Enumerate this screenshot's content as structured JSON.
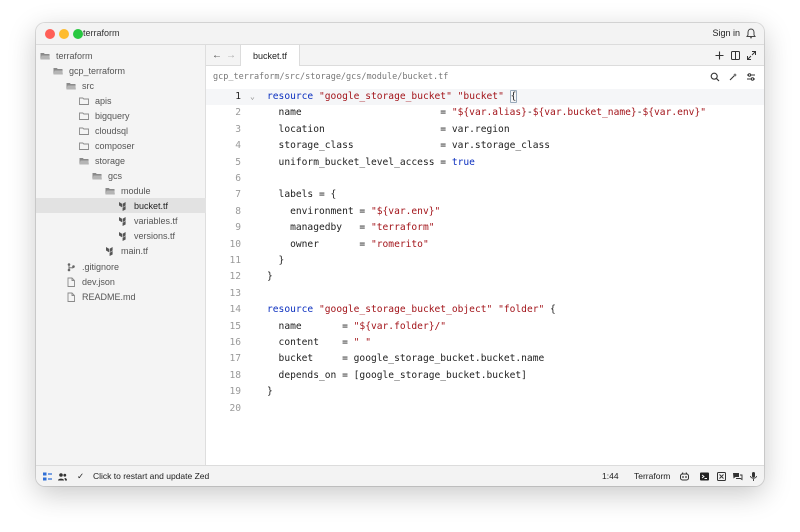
{
  "window": {
    "title": "terraform",
    "sign_in": "Sign in"
  },
  "sidebar": {
    "items": [
      {
        "label": "terraform",
        "icon": "folder-open-icon"
      },
      {
        "label": "gcp_terraform",
        "icon": "folder-open-icon"
      },
      {
        "label": "src",
        "icon": "folder-open-icon"
      },
      {
        "label": "apis",
        "icon": "folder-icon"
      },
      {
        "label": "bigquery",
        "icon": "folder-icon"
      },
      {
        "label": "cloudsql",
        "icon": "folder-icon"
      },
      {
        "label": "composer",
        "icon": "folder-icon"
      },
      {
        "label": "storage",
        "icon": "folder-open-icon"
      },
      {
        "label": "gcs",
        "icon": "folder-open-icon"
      },
      {
        "label": "module",
        "icon": "folder-open-icon"
      },
      {
        "label": "bucket.tf",
        "icon": "terraform-file-icon",
        "selected": true
      },
      {
        "label": "variables.tf",
        "icon": "terraform-file-icon"
      },
      {
        "label": "versions.tf",
        "icon": "terraform-file-icon"
      },
      {
        "label": "main.tf",
        "icon": "terraform-file-icon"
      },
      {
        "label": ".gitignore",
        "icon": "git-icon"
      },
      {
        "label": "dev.json",
        "icon": "file-icon"
      },
      {
        "label": "README.md",
        "icon": "file-icon"
      }
    ]
  },
  "tabs": [
    {
      "label": "bucket.tf",
      "active": true
    }
  ],
  "breadcrumb": "gcp_terraform/src/storage/gcs/module/bucket.tf",
  "editor": {
    "active_line": 1,
    "lines": [
      {
        "n": "1",
        "fold": "⌄",
        "tokens": [
          [
            "kw",
            "resource"
          ],
          [
            "t",
            " "
          ],
          [
            "str",
            "\"google_storage_bucket\""
          ],
          [
            "t",
            " "
          ],
          [
            "str",
            "\"bucket\""
          ],
          [
            "t",
            " "
          ],
          [
            "br",
            "{"
          ]
        ]
      },
      {
        "n": "2",
        "tokens": [
          [
            "t",
            "  name                        = "
          ],
          [
            "str",
            "\"${var.alias}"
          ],
          [
            "t",
            "-"
          ],
          [
            "str",
            "${var.bucket_name}"
          ],
          [
            "t",
            "-"
          ],
          [
            "str",
            "${var.env}\""
          ]
        ]
      },
      {
        "n": "3",
        "tokens": [
          [
            "t",
            "  location                    = var.region"
          ]
        ]
      },
      {
        "n": "4",
        "tokens": [
          [
            "t",
            "  storage_class               = var.storage_class"
          ]
        ]
      },
      {
        "n": "5",
        "tokens": [
          [
            "t",
            "  uniform_bucket_level_access = "
          ],
          [
            "kw",
            "true"
          ]
        ]
      },
      {
        "n": "6",
        "tokens": []
      },
      {
        "n": "7",
        "tokens": [
          [
            "t",
            "  labels = {"
          ]
        ]
      },
      {
        "n": "8",
        "tokens": [
          [
            "t",
            "    environment = "
          ],
          [
            "str",
            "\"${var.env}\""
          ]
        ]
      },
      {
        "n": "9",
        "tokens": [
          [
            "t",
            "    managedby   = "
          ],
          [
            "str",
            "\"terraform\""
          ]
        ]
      },
      {
        "n": "10",
        "tokens": [
          [
            "t",
            "    owner       = "
          ],
          [
            "str",
            "\"romerito\""
          ]
        ]
      },
      {
        "n": "11",
        "tokens": [
          [
            "t",
            "  }"
          ]
        ]
      },
      {
        "n": "12",
        "tokens": [
          [
            "t",
            "}"
          ]
        ]
      },
      {
        "n": "13",
        "tokens": []
      },
      {
        "n": "14",
        "tokens": [
          [
            "kw",
            "resource"
          ],
          [
            "t",
            " "
          ],
          [
            "str",
            "\"google_storage_bucket_object\""
          ],
          [
            "t",
            " "
          ],
          [
            "str",
            "\"folder\""
          ],
          [
            "t",
            " {"
          ]
        ]
      },
      {
        "n": "15",
        "tokens": [
          [
            "t",
            "  name       = "
          ],
          [
            "str",
            "\"${var.folder}/\""
          ]
        ]
      },
      {
        "n": "16",
        "tokens": [
          [
            "t",
            "  content    = "
          ],
          [
            "str",
            "\" \""
          ]
        ]
      },
      {
        "n": "17",
        "tokens": [
          [
            "t",
            "  bucket     = google_storage_bucket.bucket.name"
          ]
        ]
      },
      {
        "n": "18",
        "tokens": [
          [
            "t",
            "  depends_on = [google_storage_bucket.bucket]"
          ]
        ]
      },
      {
        "n": "19",
        "tokens": [
          [
            "t",
            "}"
          ]
        ]
      },
      {
        "n": "20",
        "tokens": []
      }
    ]
  },
  "statusbar": {
    "update_text": "Click to restart and update Zed",
    "cursor_position": "1:44",
    "language": "Terraform"
  },
  "colors": {
    "keyword": "#0b2fbf",
    "string": "#a3151b",
    "line_number": "#9a9a9a"
  }
}
